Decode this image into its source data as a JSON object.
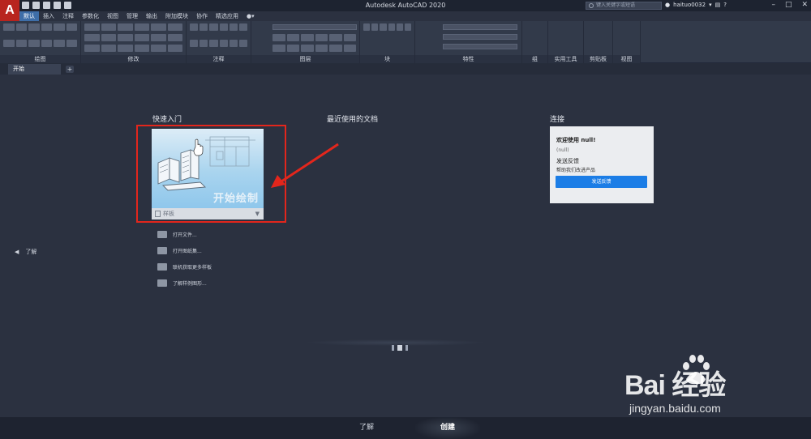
{
  "titlebar": {
    "title": "Autodesk AutoCAD 2020",
    "search_placeholder": "键入关键字或短语",
    "username": "haituo0032",
    "logo_letter": "A"
  },
  "ribbon": {
    "tabs": [
      "默认",
      "插入",
      "注释",
      "参数化",
      "视图",
      "管理",
      "输出",
      "附加模块",
      "协作",
      "精选应用"
    ],
    "active_tab": "默认",
    "panels": [
      "绘图",
      "修改",
      "注释",
      "图层",
      "块",
      "特性",
      "组",
      "实用工具",
      "剪贴板",
      "视图"
    ]
  },
  "doc_tabs": {
    "active": "开始",
    "add_label": "+"
  },
  "start": {
    "quick_start_heading": "快速入门",
    "recent_heading": "最近使用的文档",
    "connect_heading": "连接",
    "learn_side_label": "了解",
    "start_card": {
      "title": "开始绘制",
      "template_label": "样板",
      "arrow": "▼"
    },
    "actions": [
      "打开文件...",
      "打开图纸集...",
      "联机获取更多样板",
      "了解样例图形..."
    ],
    "connect": {
      "welcome": "欢迎使用 null!",
      "null_text": "(null)",
      "feedback_title": "发送反馈",
      "feedback_desc": "帮助我们改进产品",
      "feedback_button": "发送反馈"
    }
  },
  "bottom_tabs": [
    "了解",
    "创建"
  ],
  "bottom_active": "创建",
  "watermark": {
    "text": "Bai 经验",
    "url": "jingyan.baidu.com"
  },
  "colors": {
    "accent": "#1b7de6",
    "highlight_box": "#e3261c",
    "logo": "#b8241e"
  }
}
